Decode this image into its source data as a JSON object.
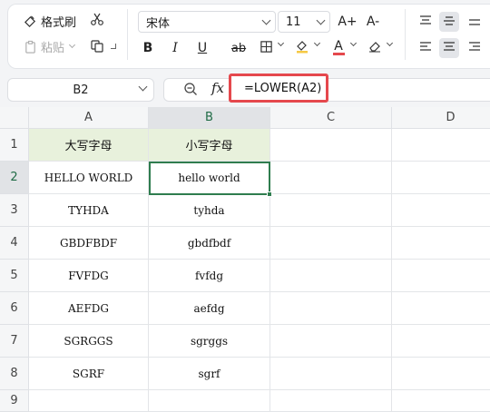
{
  "toolbar": {
    "format_painter_label": "格式刷",
    "paste_label": "粘贴",
    "font_name": "宋体",
    "font_size": "11",
    "grow_font_label": "A+",
    "shrink_font_label": "A-",
    "bold_label": "B",
    "italic_label": "I",
    "underline_label": "U",
    "strike_label": "ab",
    "font_color_label": "A",
    "font_color": "#e5484d",
    "fill_color": "#f6c945"
  },
  "formula_bar": {
    "cell_ref": "B2",
    "fx_label": "fx",
    "formula": "=LOWER(A2)"
  },
  "sheet": {
    "columns": [
      "A",
      "B",
      "C",
      "D"
    ],
    "rows": [
      "1",
      "2",
      "3",
      "4",
      "5",
      "6",
      "7",
      "8",
      "9"
    ],
    "header_a": "大写字母",
    "header_b": "小写字母",
    "data": [
      {
        "a": "HELLO WORLD",
        "b": "hello world"
      },
      {
        "a": "TYHDA",
        "b": "tyhda"
      },
      {
        "a": "GBDFBDF",
        "b": "gbdfbdf"
      },
      {
        "a": "FVFDG",
        "b": "fvfdg"
      },
      {
        "a": "AEFDG",
        "b": "aefdg"
      },
      {
        "a": "SGRGGS",
        "b": "sgrggs"
      },
      {
        "a": "SGRF",
        "b": "sgrf"
      }
    ],
    "accent": "#2f7d4f"
  }
}
